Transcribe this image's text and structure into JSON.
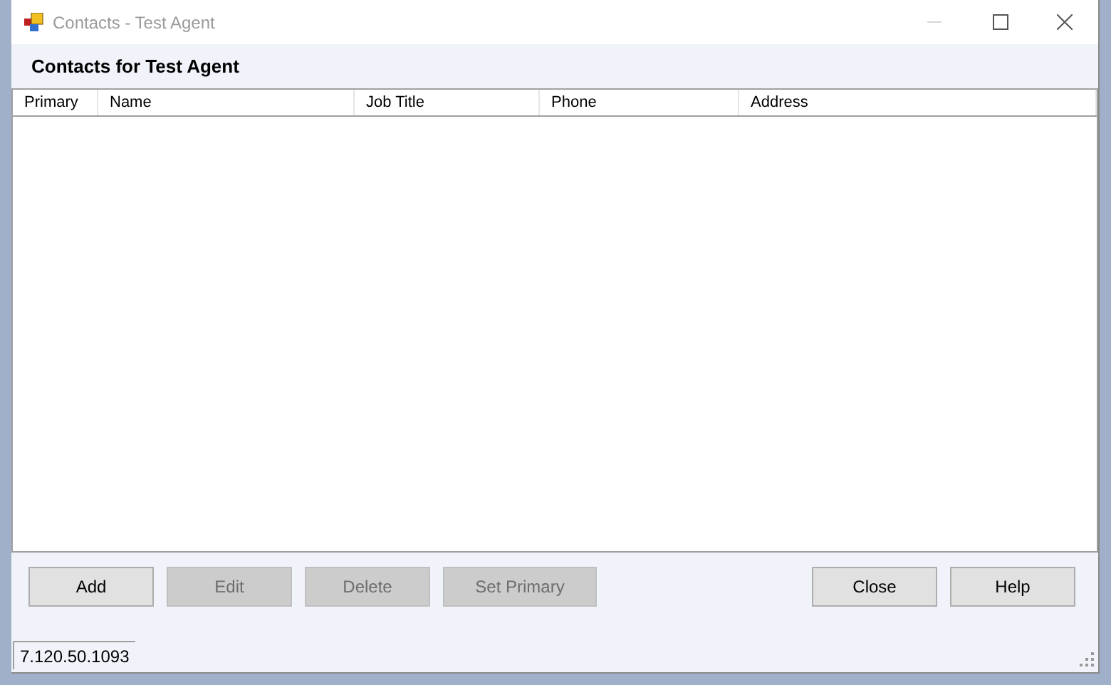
{
  "window": {
    "title": "Contacts - Test Agent"
  },
  "heading": "Contacts for Test Agent",
  "table": {
    "columns": [
      "Primary",
      "Name",
      "Job Title",
      "Phone",
      "Address"
    ]
  },
  "buttons": [
    {
      "label": "Add",
      "disabled": false
    },
    {
      "label": "Edit",
      "disabled": true
    },
    {
      "label": "Delete",
      "disabled": true
    },
    {
      "label": "Set Primary",
      "disabled": true
    }
  ],
  "right_buttons": [
    {
      "label": "Close",
      "disabled": false
    },
    {
      "label": "Help",
      "disabled": false
    }
  ],
  "status_bar": {
    "version": "7.120.50.1093"
  }
}
